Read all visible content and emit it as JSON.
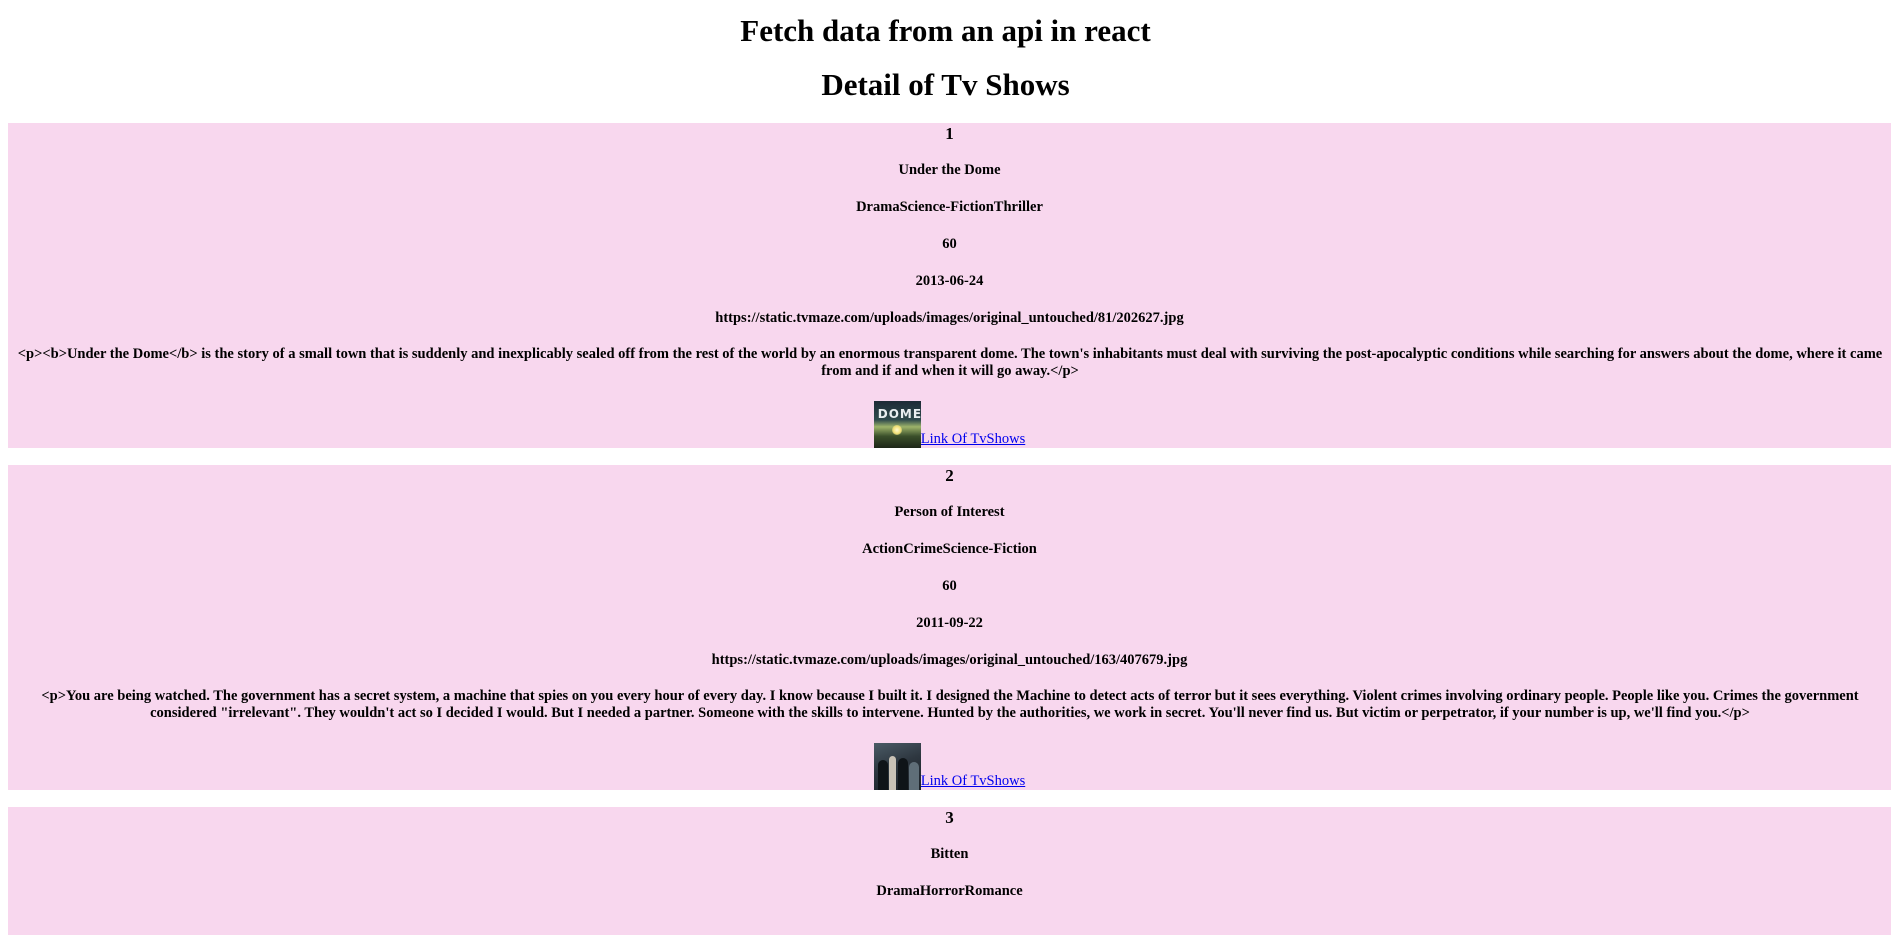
{
  "header": {
    "title": "Fetch data from an api in react",
    "subtitle": "Detail of Tv Shows"
  },
  "shows": [
    {
      "id": "1",
      "name": "Under the Dome",
      "genres": "DramaScience-FictionThriller",
      "runtime": "60",
      "premiered": "2013-06-24",
      "image_url": "https://static.tvmaze.com/uploads/images/original_untouched/81/202627.jpg",
      "summary": "<p><b>Under the Dome</b> is the story of a small town that is suddenly and inexplicably sealed off from the rest of the world by an enormous transparent dome. The town's inhabitants must deal with surviving the post-apocalyptic conditions while searching for answers about the dome, where it came from and if and when it will go away.</p>",
      "link_label": "Link Of TvShows",
      "thumb_text": "DOME"
    },
    {
      "id": "2",
      "name": "Person of Interest",
      "genres": "ActionCrimeScience-Fiction",
      "runtime": "60",
      "premiered": "2011-09-22",
      "image_url": "https://static.tvmaze.com/uploads/images/original_untouched/163/407679.jpg",
      "summary": "<p>You are being watched. The government has a secret system, a machine that spies on you every hour of every day. I know because I built it. I designed the Machine to detect acts of terror but it sees everything. Violent crimes involving ordinary people. People like you. Crimes the government considered \"irrelevant\". They wouldn't act so I decided I would. But I needed a partner. Someone with the skills to intervene. Hunted by the authorities, we work in secret. You'll never find us. But victim or perpetrator, if your number is up, we'll find you.</p>",
      "link_label": "Link Of TvShows"
    },
    {
      "id": "3",
      "name": "Bitten",
      "genres": "DramaHorrorRomance"
    }
  ]
}
